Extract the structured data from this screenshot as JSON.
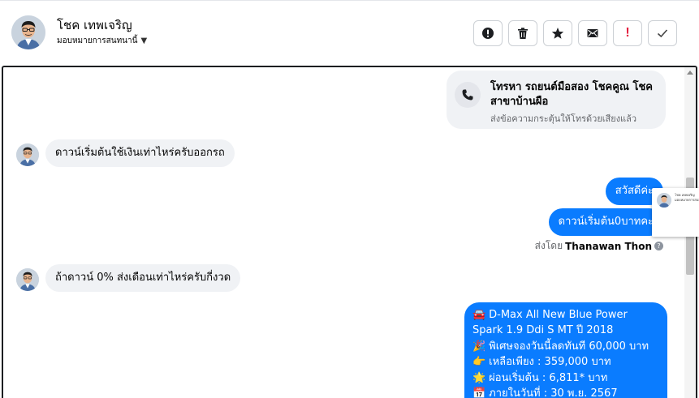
{
  "header": {
    "contact_name": "โชค เทพเจริญ",
    "assign_label": "มอบหมายการสนทนานี้",
    "actions": [
      {
        "name": "report",
        "icon": "exclamation-circle-icon"
      },
      {
        "name": "delete",
        "icon": "trash-icon"
      },
      {
        "name": "star",
        "icon": "star-icon"
      },
      {
        "name": "mark-unread",
        "icon": "envelope-icon"
      },
      {
        "name": "mark-important",
        "icon": "red-exclamation-icon"
      },
      {
        "name": "done",
        "icon": "checkmark-icon"
      }
    ]
  },
  "call_card": {
    "title": "โทรหา รถยนต์มือสอง โชคคูณ โชค สาขาบ้านผือ",
    "subtitle": "ส่งข้อความกระตุ้นให้โทรด้วยเสียงแล้ว",
    "icon": "phone-icon"
  },
  "messages": {
    "incoming_1": "ดาวน์เริ่มต้นใช้เงินเท่าไหร่ครับออกรถ",
    "outgoing_1": "สวัสดีค่ะ",
    "outgoing_2": "ดาวน์เริ่มต้น0บาทคะ",
    "sent_by_prefix": "ส่งโดย",
    "sent_by_name": "Thanawan Thon",
    "incoming_2": "ถ้าดาวน์ 0% ส่งเดือนเท่าไหร่ครับกี่งวด",
    "offer_lines": [
      "D-Max All New Blue Power",
      "Spark 1.9 Ddi S MT ปี 2018",
      "พิเศษจองวันนี้ลดทันที 60,000 บาท",
      "เหลือเพียง : 359,000 บาท",
      "ผ่อนเริ่มต้น : 6,811* บาท",
      "ภายในวันที่ : 30 พ.ย. 2567"
    ],
    "offer_emojis": [
      "🚘",
      "",
      "🎉",
      "👉",
      "🌟",
      "📅"
    ]
  },
  "popup": {
    "text_line1": "โชค เทพเจริญ",
    "text_line2": "มอบหมายการสนทนานี้"
  },
  "colors": {
    "accent": "#0a7cff",
    "incoming_bubble": "#f0f2f5",
    "alert_red": "#e41e3f"
  }
}
